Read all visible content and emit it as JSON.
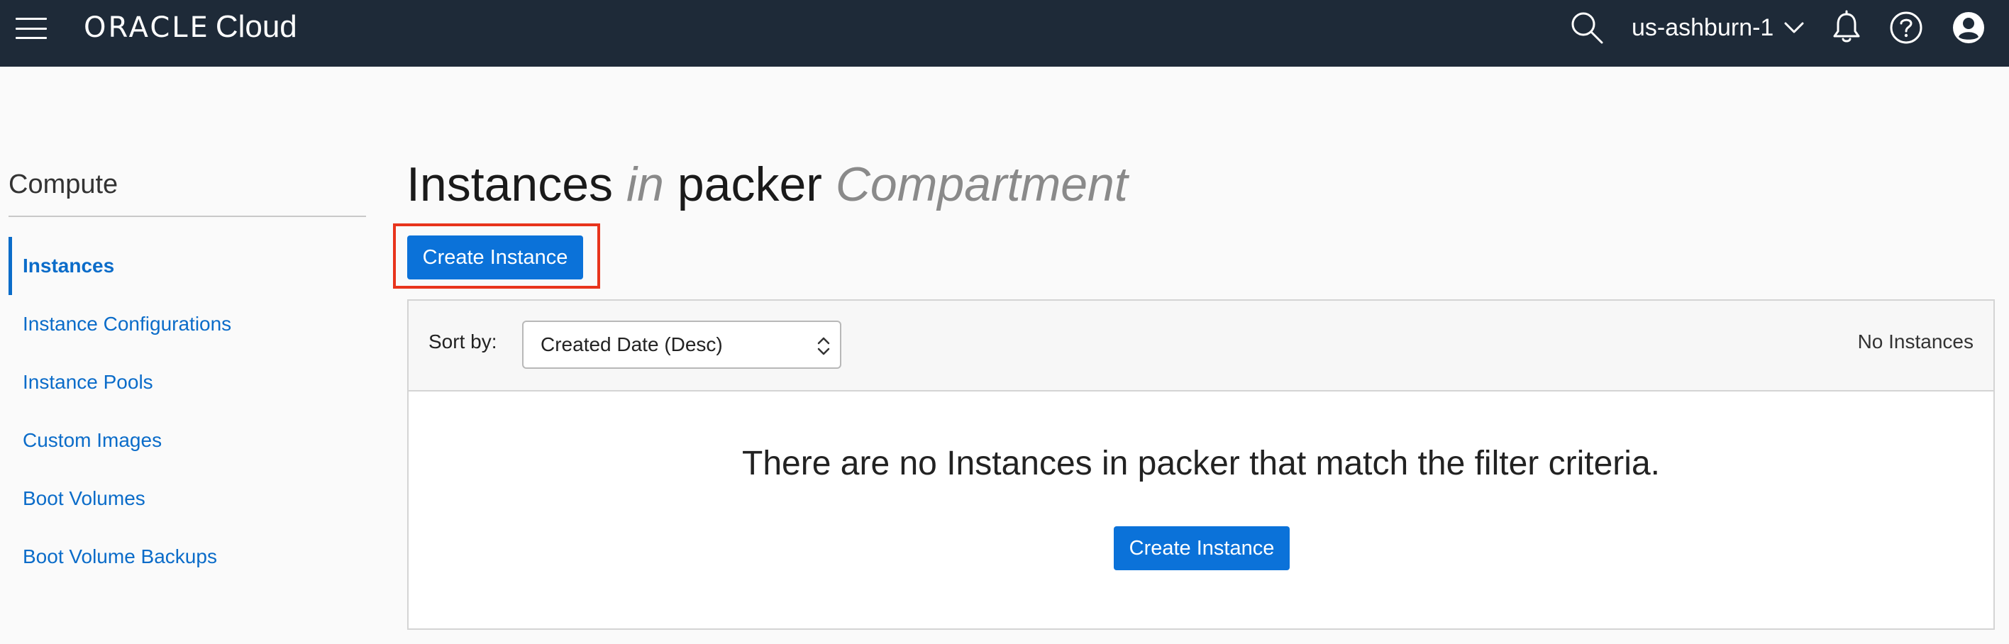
{
  "topbar": {
    "brand": "ORACLE",
    "product": "Cloud",
    "region": "us-ashburn-1",
    "icons": [
      "menu-icon",
      "search-icon",
      "chevron-down-icon",
      "bell-icon",
      "help-icon",
      "user-icon"
    ],
    "background": "#1e2a38"
  },
  "sidebar": {
    "title": "Compute",
    "items": [
      {
        "label": "Instances",
        "active": true
      },
      {
        "label": "Instance Configurations",
        "active": false
      },
      {
        "label": "Instance Pools",
        "active": false
      },
      {
        "label": "Custom Images",
        "active": false
      },
      {
        "label": "Boot Volumes",
        "active": false
      },
      {
        "label": "Boot Volume Backups",
        "active": false
      }
    ],
    "link_color": "#0b6cc9"
  },
  "main": {
    "title": {
      "part1": "Instances",
      "part2": "in",
      "part3": "packer",
      "part4": "Compartment"
    },
    "create_button_label": "Create Instance",
    "highlight_color": "#e8341c",
    "button_color": "#0b72d9",
    "toolbar": {
      "sort_label": "Sort by:",
      "sort_value": "Created Date (Desc)",
      "count_label": "No Instances"
    },
    "empty_state": {
      "message": "There are no Instances in packer that match the filter criteria.",
      "button_label": "Create Instance"
    }
  }
}
